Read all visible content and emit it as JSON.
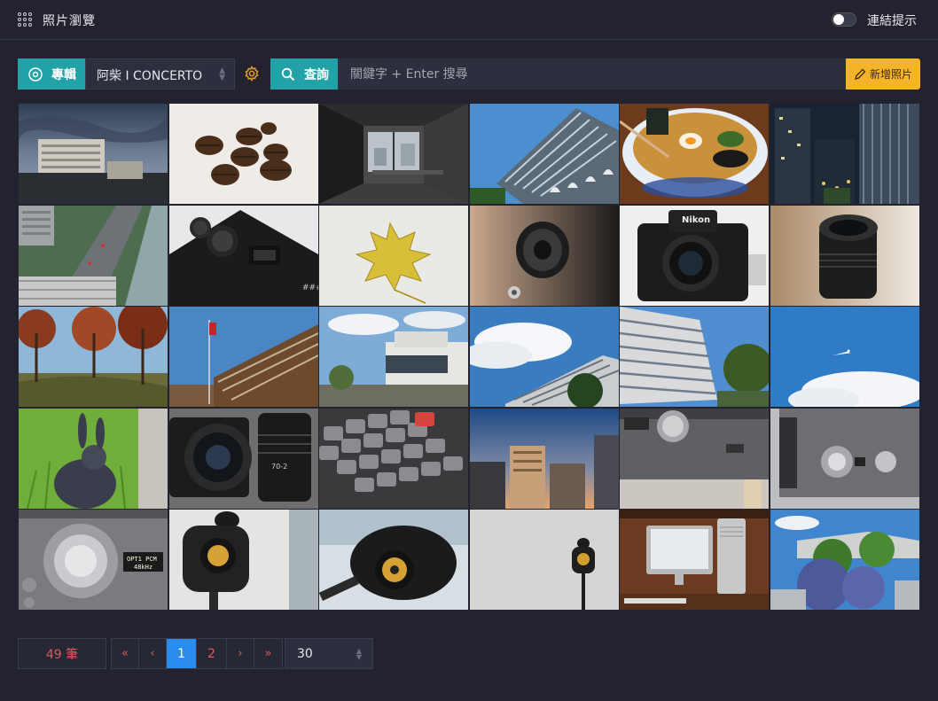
{
  "header": {
    "title": "照片瀏覽",
    "link_hint_label": "連結提示",
    "link_hint_on": false
  },
  "toolbar": {
    "album_label": "專輯",
    "album_value": "阿柴 I CONCERTO",
    "query_label": "查詢",
    "search_placeholder": "關鍵字 + Enter 搜尋",
    "search_value": "",
    "add_photo_label": "新增照片"
  },
  "photos": [
    {
      "icon": "city-skyline-photo"
    },
    {
      "icon": "coffee-beans-photo"
    },
    {
      "icon": "empty-room-photo"
    },
    {
      "icon": "glass-building-photo"
    },
    {
      "icon": "ramen-bowl-photo"
    },
    {
      "icon": "night-city-photo"
    },
    {
      "icon": "street-aerial-photo"
    },
    {
      "icon": "camera-dials-photo"
    },
    {
      "icon": "yellow-leaf-photo"
    },
    {
      "icon": "speaker-driver-photo"
    },
    {
      "icon": "nikon-camera-photo"
    },
    {
      "icon": "camera-lens-photo"
    },
    {
      "icon": "autumn-trees-photo"
    },
    {
      "icon": "flag-building-photo"
    },
    {
      "icon": "modern-house-photo"
    },
    {
      "icon": "condo-clouds-photo"
    },
    {
      "icon": "condo-tower-photo"
    },
    {
      "icon": "airplane-sky-photo"
    },
    {
      "icon": "rabbit-grass-photo"
    },
    {
      "icon": "camera-lenses-photo"
    },
    {
      "icon": "keyboard-photo"
    },
    {
      "icon": "sunset-city-photo"
    },
    {
      "icon": "amplifier-knob-photo"
    },
    {
      "icon": "amplifier-front-photo"
    },
    {
      "icon": "amplifier-display-photo"
    },
    {
      "icon": "speaker-stand-photo"
    },
    {
      "icon": "speaker-closeup-photo"
    },
    {
      "icon": "speaker-white-wall-photo"
    },
    {
      "icon": "computer-desk-photo"
    },
    {
      "icon": "garden-flowers-photo"
    }
  ],
  "pagination": {
    "total_label": "49 筆",
    "first": "«",
    "prev": "‹",
    "pages": [
      "1",
      "2"
    ],
    "current_page": "1",
    "next": "›",
    "last": "»",
    "per_page": "30"
  },
  "colors": {
    "accent": "#22a1a7",
    "add_button": "#f4b429",
    "active_page": "#2b8cf0",
    "count_text": "#e05a5a",
    "background": "#22232e"
  }
}
